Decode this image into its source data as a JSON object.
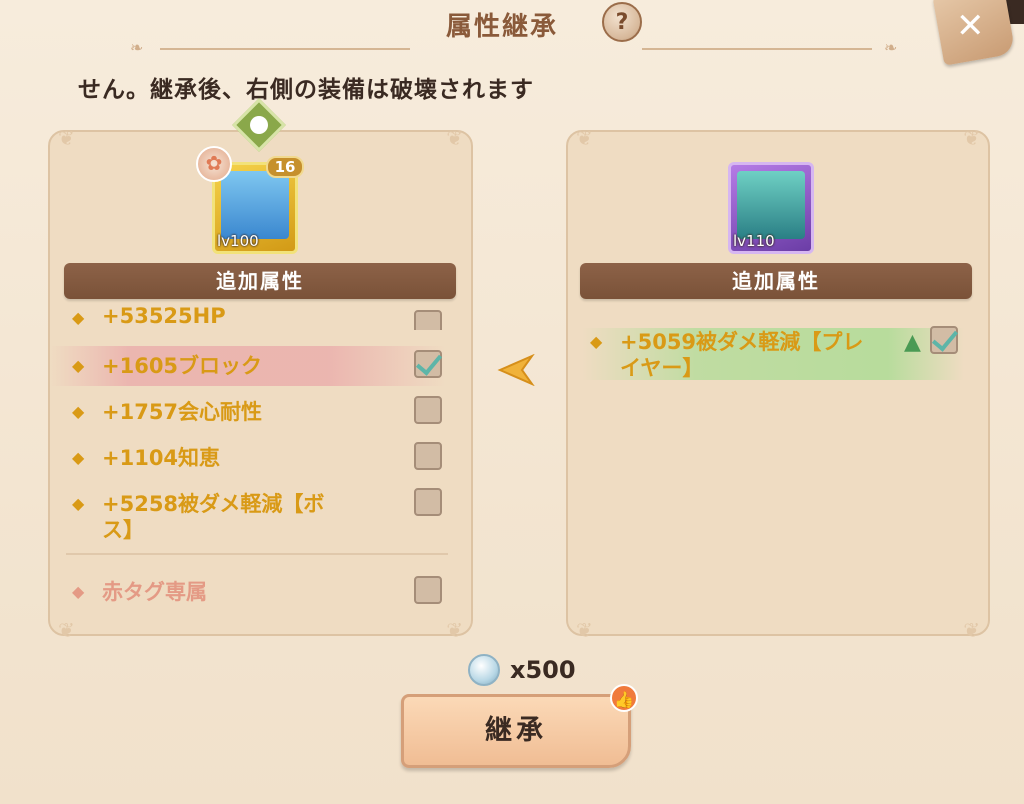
{
  "title": "属性継承",
  "help_icon": "?",
  "close_icon": "✕",
  "notice": "せん。継承後、右側の装備は破壊されます",
  "left_item": {
    "level_label": "lv100",
    "badge": "16",
    "banner": "追加属性",
    "attributes": [
      {
        "text": "+53525HP",
        "checked": false
      },
      {
        "text": "+1605ブロック",
        "checked": true
      },
      {
        "text": "+1757会心耐性",
        "checked": false
      },
      {
        "text": "+1104知恵",
        "checked": false
      },
      {
        "text": "+5258被ダメ軽減【ボス】",
        "line1": "+5258被ダメ軽減【ボ",
        "line2": "ス】",
        "checked": false
      }
    ],
    "exclusive": {
      "text": "赤タグ専属",
      "checked": false
    }
  },
  "right_item": {
    "level_label": "lv110",
    "banner": "追加属性",
    "attributes": [
      {
        "line1": "+5059被ダメ軽減【プレ",
        "line2": "イヤー】",
        "checked": true
      }
    ]
  },
  "cost": {
    "amount": "x500"
  },
  "button": {
    "label": "継承"
  },
  "colors": {
    "accent_gold": "#d99a16",
    "banner_brown": "#7a5238",
    "exclusive_pink": "#e49a85",
    "check_teal": "#5db5a8"
  }
}
